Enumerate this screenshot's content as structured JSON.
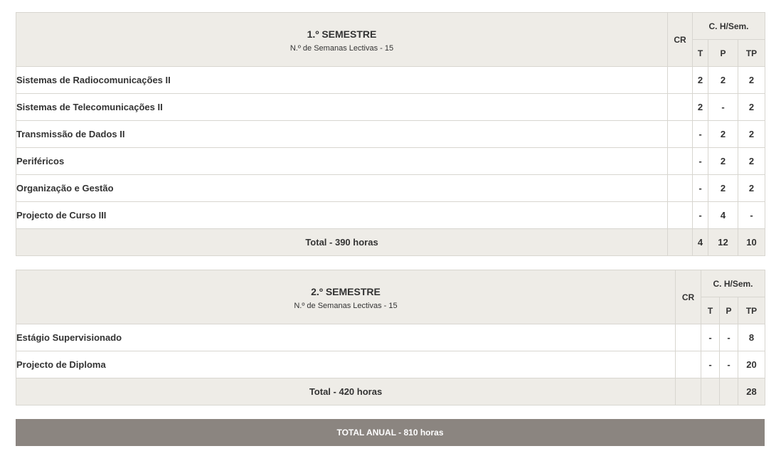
{
  "semester1": {
    "title": "1.º SEMESTRE",
    "subtitle": "N.º de Semanas Lectivas - 15",
    "cr_label": "CR",
    "ch_label": "C. H/Sem.",
    "t_label": "T",
    "p_label": "P",
    "tp_label": "TP",
    "rows": [
      {
        "name": "Sistemas de Radiocomunicações II",
        "cr": "",
        "t": "2",
        "p": "2",
        "tp": "2"
      },
      {
        "name": "Sistemas de Telecomunicações II",
        "cr": "",
        "t": "2",
        "p": "-",
        "tp": "2"
      },
      {
        "name": "Transmissão de Dados II",
        "cr": "",
        "t": "-",
        "p": "2",
        "tp": "2"
      },
      {
        "name": "Periféricos",
        "cr": "",
        "t": "-",
        "p": "2",
        "tp": "2"
      },
      {
        "name": "Organização e Gestão",
        "cr": "",
        "t": "-",
        "p": "2",
        "tp": "2"
      },
      {
        "name": "Projecto de Curso III",
        "cr": "",
        "t": "-",
        "p": "4",
        "tp": "-"
      }
    ],
    "total": {
      "label": "Total - 390 horas",
      "cr": "",
      "t": "4",
      "p": "12",
      "tp": "10"
    }
  },
  "semester2": {
    "title": "2.º SEMESTRE",
    "subtitle": "N.º de Semanas Lectivas - 15",
    "cr_label": "CR",
    "ch_label": "C. H/Sem.",
    "t_label": "T",
    "p_label": "P",
    "tp_label": "TP",
    "rows": [
      {
        "name": "Estágio Supervisionado",
        "cr": "",
        "t": "-",
        "p": "-",
        "tp": "8"
      },
      {
        "name": "Projecto de Diploma",
        "cr": "",
        "t": "-",
        "p": "-",
        "tp": "20"
      }
    ],
    "total": {
      "label": "Total - 420 horas",
      "cr": "",
      "t": "",
      "p": "",
      "tp": "28"
    }
  },
  "grand_total": "TOTAL ANUAL - 810 horas"
}
